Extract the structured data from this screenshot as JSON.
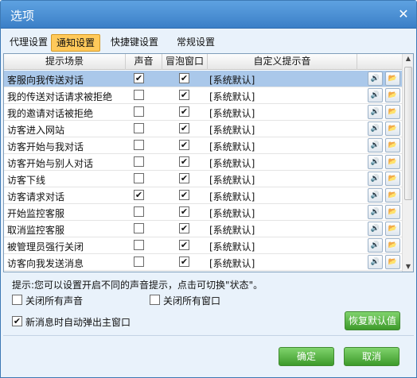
{
  "window": {
    "title": "选项",
    "close_glyph": "✕"
  },
  "tabs": [
    {
      "label": "代理设置",
      "active": false
    },
    {
      "label": "通知设置",
      "active": true
    },
    {
      "label": "快捷键设置",
      "active": false
    },
    {
      "label": "常规设置",
      "active": false
    }
  ],
  "table": {
    "columns": [
      "提示场景",
      "声音",
      "冒泡窗口",
      "自定义提示音"
    ],
    "rows": [
      {
        "scene": "客服向我传送对话",
        "sound": true,
        "bubble": true,
        "tip": "[系统默认]",
        "selected": true
      },
      {
        "scene": "我的传送对话请求被拒绝",
        "sound": false,
        "bubble": true,
        "tip": "[系统默认]",
        "selected": false
      },
      {
        "scene": "我的邀请对话被拒绝",
        "sound": false,
        "bubble": true,
        "tip": "[系统默认]",
        "selected": false
      },
      {
        "scene": "访客进入网站",
        "sound": false,
        "bubble": true,
        "tip": "[系统默认]",
        "selected": false
      },
      {
        "scene": "访客开始与我对话",
        "sound": false,
        "bubble": true,
        "tip": "[系统默认]",
        "selected": false
      },
      {
        "scene": "访客开始与别人对话",
        "sound": false,
        "bubble": true,
        "tip": "[系统默认]",
        "selected": false
      },
      {
        "scene": "访客下线",
        "sound": false,
        "bubble": true,
        "tip": "[系统默认]",
        "selected": false
      },
      {
        "scene": "访客请求对话",
        "sound": true,
        "bubble": true,
        "tip": "[系统默认]",
        "selected": false
      },
      {
        "scene": "开始监控客服",
        "sound": false,
        "bubble": true,
        "tip": "[系统默认]",
        "selected": false
      },
      {
        "scene": "取消监控客服",
        "sound": false,
        "bubble": true,
        "tip": "[系统默认]",
        "selected": false
      },
      {
        "scene": "被管理员强行关闭",
        "sound": false,
        "bubble": true,
        "tip": "[系统默认]",
        "selected": false
      },
      {
        "scene": "访客向我发送消息",
        "sound": false,
        "bubble": true,
        "tip": "[系统默认]",
        "selected": false
      }
    ],
    "icons": {
      "play": "speaker-icon",
      "browse": "folder-icon"
    }
  },
  "hint": "提示:您可以设置开启不同的声音提示，点击可切换\"状态\"。",
  "options": {
    "mute_all": {
      "label": "关闭所有声音",
      "checked": false
    },
    "close_windows": {
      "label": "关闭所有窗口",
      "checked": false
    },
    "auto_popup": {
      "label": "新消息时自动弹出主窗口",
      "checked": true
    }
  },
  "buttons": {
    "restore": "恢复默认值",
    "ok": "确定",
    "cancel": "取消"
  },
  "colors": {
    "title_bar": "#4a8fd4",
    "active_tab": "#ffc95a",
    "selected_row": "#aac8ea",
    "green_button": "#4fae3a"
  }
}
